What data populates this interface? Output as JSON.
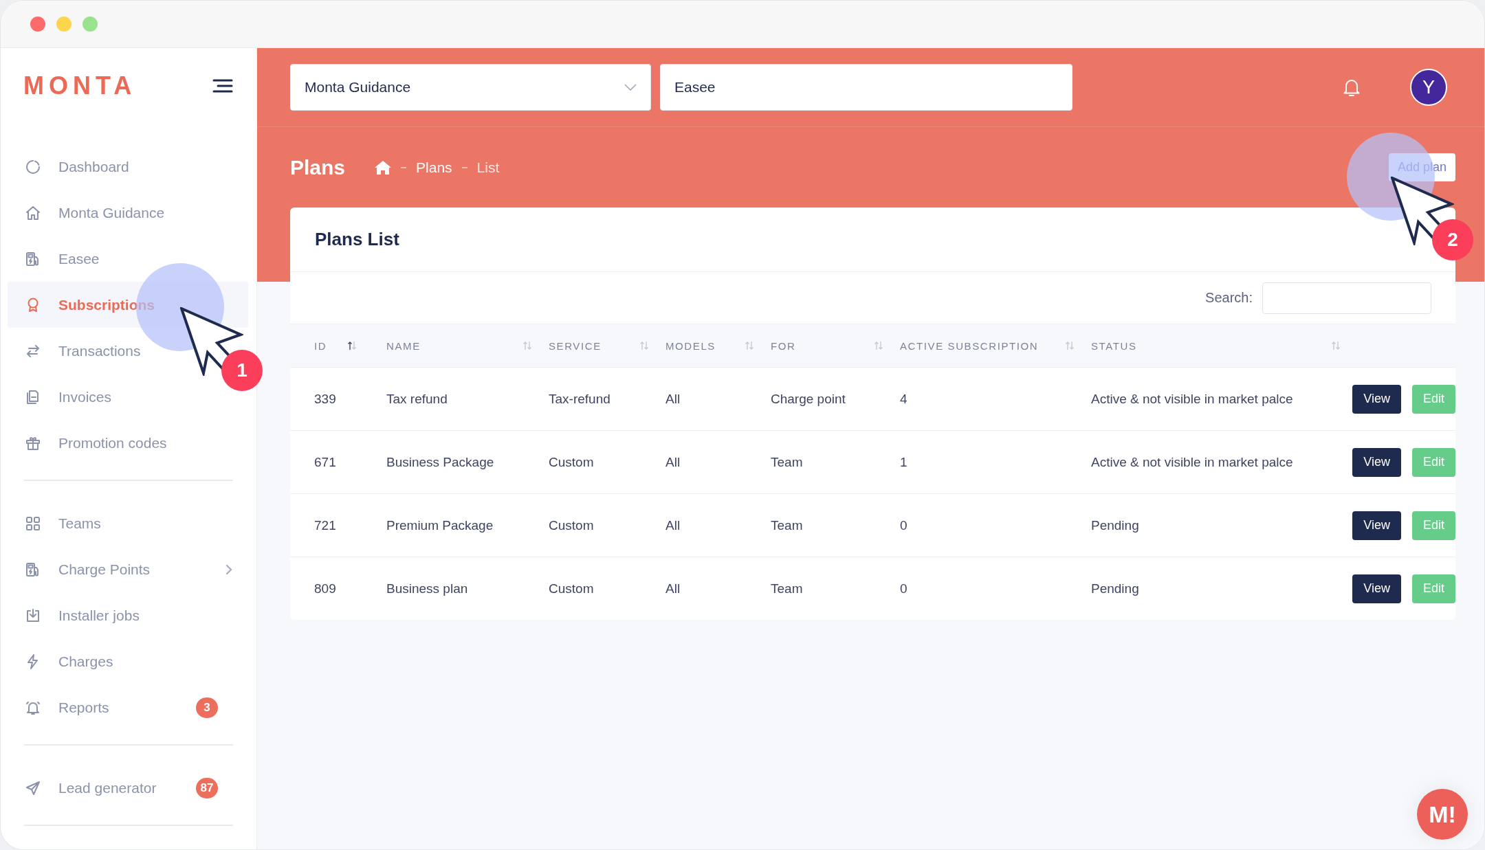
{
  "sidebar": {
    "logo": "MONTA",
    "sections": [
      {
        "items": [
          {
            "label": "Dashboard",
            "selected": false
          },
          {
            "label": "Monta Guidance",
            "selected": false
          },
          {
            "label": "Easee",
            "selected": false
          },
          {
            "label": "Subscriptions",
            "selected": true
          },
          {
            "label": "Transactions",
            "selected": false
          },
          {
            "label": "Invoices",
            "selected": false
          },
          {
            "label": "Promotion codes",
            "selected": false
          }
        ]
      },
      {
        "items": [
          {
            "label": "Teams",
            "selected": false
          },
          {
            "label": "Charge Points",
            "selected": false,
            "expandable": true
          },
          {
            "label": "Installer jobs",
            "selected": false
          },
          {
            "label": "Charges",
            "selected": false
          },
          {
            "label": "Reports",
            "selected": false,
            "badge": "3"
          }
        ]
      },
      {
        "items": [
          {
            "label": "Lead generator",
            "selected": false,
            "badge": "87"
          }
        ]
      }
    ]
  },
  "header": {
    "fields": [
      {
        "kind": "dropdown",
        "value": "Monta Guidance"
      },
      {
        "kind": "text",
        "value": "Easee"
      }
    ],
    "avatar": "Y"
  },
  "page": {
    "title": "Plans",
    "breadcrumb": [
      "Plans",
      "List"
    ],
    "action": "Add plan"
  },
  "table": {
    "title": "Plans List",
    "search_label": "Search:",
    "columns": [
      {
        "label": "ID",
        "sorted": true
      },
      {
        "label": "NAME",
        "sorted": false
      },
      {
        "label": "SERVICE",
        "sorted": false
      },
      {
        "label": "MODELS",
        "sorted": false
      },
      {
        "label": "FOR",
        "sorted": false
      },
      {
        "label": "ACTIVE SUBSCRIPTION",
        "sorted": false
      },
      {
        "label": "STATUS",
        "sorted": false
      }
    ],
    "rows": [
      {
        "cells": [
          "339",
          "Tax refund",
          "Tax-refund",
          "All",
          "Charge point",
          "4",
          "Active & not visible in market palce"
        ],
        "actions": [
          {
            "kind": "view",
            "label": "View"
          },
          {
            "kind": "edit",
            "label": "Edit"
          }
        ]
      },
      {
        "cells": [
          "671",
          "Business Package",
          "Custom",
          "All",
          "Team",
          "1",
          "Active & not visible in market palce"
        ],
        "actions": [
          {
            "kind": "view",
            "label": "View"
          },
          {
            "kind": "edit",
            "label": "Edit"
          }
        ]
      },
      {
        "cells": [
          "721",
          "Premium Package",
          "Custom",
          "All",
          "Team",
          "0",
          "Pending"
        ],
        "actions": [
          {
            "kind": "view",
            "label": "View"
          },
          {
            "kind": "edit",
            "label": "Edit"
          }
        ]
      },
      {
        "cells": [
          "809",
          "Business plan",
          "Custom",
          "All",
          "Team",
          "0",
          "Pending"
        ],
        "actions": [
          {
            "kind": "view",
            "label": "View"
          },
          {
            "kind": "edit",
            "label": "Edit"
          }
        ]
      }
    ]
  },
  "chat_button": {
    "label": "M!"
  },
  "annotations": [
    {
      "number": "1"
    },
    {
      "number": "2"
    }
  ]
}
